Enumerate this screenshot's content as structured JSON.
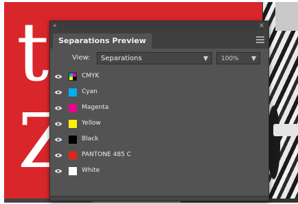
{
  "panel": {
    "tab_label": "Separations Preview",
    "view_label": "View:",
    "view_value": "Separations",
    "zoom_value": "100%"
  },
  "separations": [
    {
      "label": "CMYK",
      "swatch": "cmyk",
      "color": "#000000"
    },
    {
      "label": "Cyan",
      "swatch": "solid",
      "color": "#00aeef"
    },
    {
      "label": "Magenta",
      "swatch": "solid",
      "color": "#ec008c"
    },
    {
      "label": "Yellow",
      "swatch": "solid",
      "color": "#fff200"
    },
    {
      "label": "Black",
      "swatch": "solid",
      "color": "#000000"
    },
    {
      "label": "PANTONE 485 C",
      "swatch": "solid",
      "color": "#da291c"
    },
    {
      "label": "White",
      "swatch": "solid",
      "color": "#ffffff"
    }
  ],
  "document": {
    "letter_top": "t",
    "letter_bottom": "Z",
    "background_color": "#d9262a"
  }
}
